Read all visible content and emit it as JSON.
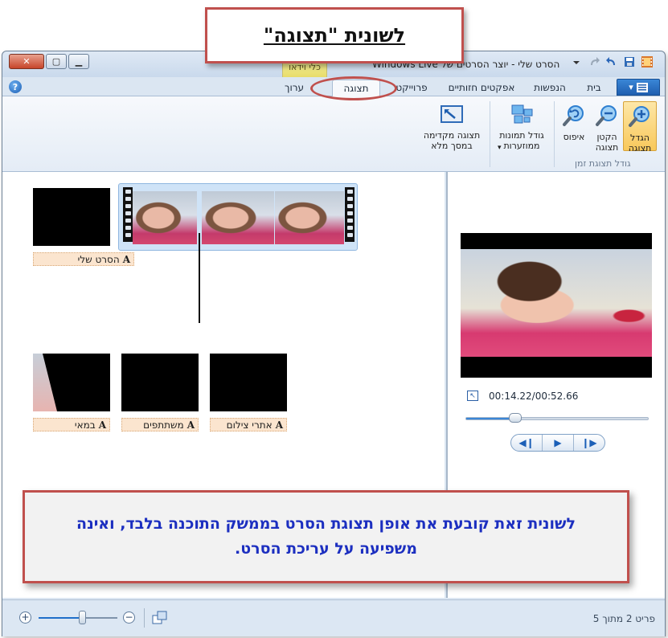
{
  "annotations": {
    "top_title": "לשונית \"תצוגה\"",
    "bottom_note": "לשונית זאת קובעת את אופן תצוגת הסרט בממשק התוכנה בלבד, ואינה משפיעה על עריכת הסרט."
  },
  "window": {
    "title": "הסרט שלי - יוצר הסרטים של Windows Live",
    "context_group": "כלי וידאו"
  },
  "tabs": {
    "home": "בית",
    "animations": "הנפשות",
    "visual_effects": "אפקטים חזותיים",
    "project": "פרוייקט",
    "view": "תצוגה",
    "edit": "ערוך",
    "active": "view"
  },
  "ribbon": {
    "zoom_in": "הגדל\nתצוגה",
    "zoom_out": "הקטן\nתצוגה",
    "reset": "איפוס",
    "thumbnail_size": "גודל תמונות\nממוזערות",
    "fullscreen_preview": "תצוגה מקדימה\nבמסך מלא",
    "group_label": "גודל תצוגת זמן"
  },
  "storyboard": {
    "captions": {
      "my_movie": "הסרט שלי",
      "director": "במאי",
      "cast": "משתתפים",
      "locations": "אתרי צילום"
    },
    "caption_glyph": "A"
  },
  "preview": {
    "time": "00:14.22/00:52.66",
    "progress": 0.27
  },
  "status": {
    "item_text": "פריט 2 מתוך 5",
    "zoom_level": 0.55
  },
  "colors": {
    "accent_red": "#c0504d",
    "note_blue": "#1c2fc0",
    "caption_bg": "#fbe5cf"
  }
}
